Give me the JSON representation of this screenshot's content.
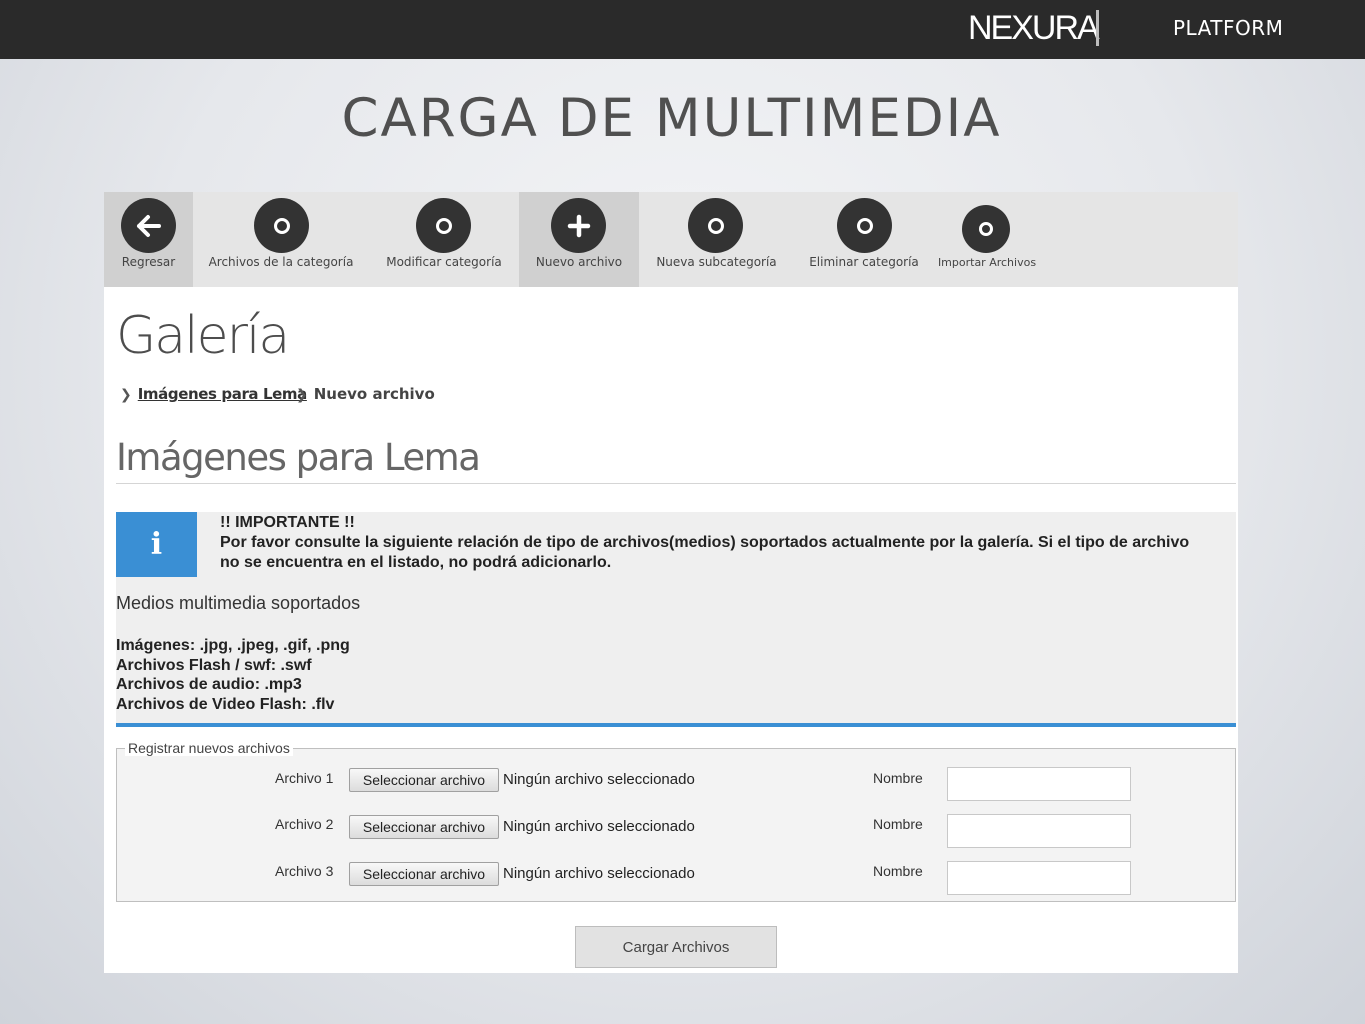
{
  "header": {
    "logo": "NEXURA",
    "platform": "PLATFORM"
  },
  "slide_title": "CARGA DE MULTIMEDIA",
  "toolbar": {
    "items": [
      {
        "label": "Regresar",
        "icon": "arrow-left-icon",
        "glyph": "🡐"
      },
      {
        "label": "Archivos de la categoría",
        "icon": "circle-icon"
      },
      {
        "label": "Modificar categoría",
        "icon": "circle-icon"
      },
      {
        "label": "Nuevo archivo",
        "icon": "plus-icon",
        "glyph": "+"
      },
      {
        "label": "Nueva subcategoría",
        "icon": "circle-icon"
      },
      {
        "label": "Eliminar categoría",
        "icon": "circle-icon"
      },
      {
        "label": "Importar Archivos",
        "icon": "circle-icon"
      }
    ]
  },
  "page": {
    "title": "Galería",
    "breadcrumb": {
      "item1": "Imágenes para Lema",
      "item2": "Nuevo archivo"
    },
    "subtitle": "Imágenes para Lema"
  },
  "notice": {
    "icon_glyph": "i",
    "heading": "!! IMPORTANTE !!",
    "body": "Por favor consulte la siguiente relación de tipo de archivos(medios) soportados actualmente por la galería. Si el tipo de archivo no se encuentra en el listado, no podrá adicionarlo.",
    "media_title": "Medios multimedia soportados",
    "media": [
      "Imágenes:  .jpg,  .jpeg,  .gif,  .png",
      "Archivos Flash / swf:  .swf",
      "Archivos de audio:  .mp3",
      "Archivos de Video Flash:  .flv"
    ]
  },
  "form": {
    "legend": "Registrar nuevos archivos",
    "rows": [
      {
        "label": "Archivo 1",
        "button": "Seleccionar archivo",
        "status": "Ningún archivo seleccionado",
        "name_label": "Nombre",
        "name_value": ""
      },
      {
        "label": "Archivo 2",
        "button": "Seleccionar archivo",
        "status": "Ningún archivo seleccionado",
        "name_label": "Nombre",
        "name_value": ""
      },
      {
        "label": "Archivo 3",
        "button": "Seleccionar archivo",
        "status": "Ningún archivo seleccionado",
        "name_label": "Nombre",
        "name_value": ""
      }
    ],
    "submit": "Cargar Archivos"
  },
  "colors": {
    "accent": "#3a8fd4",
    "topbar": "#2a2a2a",
    "toolbar": "#e5e5e5"
  }
}
